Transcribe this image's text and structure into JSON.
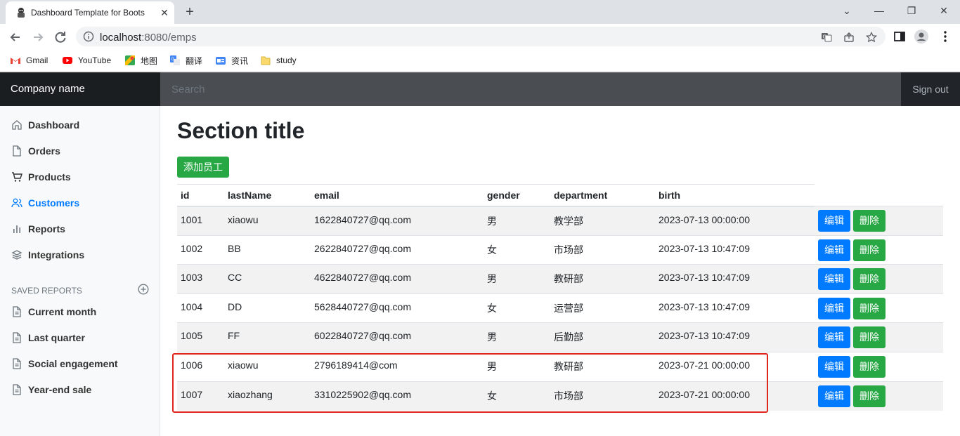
{
  "browser": {
    "tab_title": "Dashboard Template for Boots",
    "url_host": "localhost",
    "url_path": ":8080/emps",
    "bookmarks": [
      {
        "label": "Gmail",
        "icon": "gmail-icon"
      },
      {
        "label": "YouTube",
        "icon": "youtube-icon"
      },
      {
        "label": "地图",
        "icon": "maps-icon"
      },
      {
        "label": "翻译",
        "icon": "translate-icon"
      },
      {
        "label": "资讯",
        "icon": "news-icon"
      },
      {
        "label": "study",
        "icon": "folder-icon"
      }
    ]
  },
  "navbar": {
    "brand": "Company name",
    "search_placeholder": "Search",
    "sign_out": "Sign out"
  },
  "sidebar": {
    "items": [
      {
        "label": "Dashboard",
        "icon": "home-icon",
        "active": false
      },
      {
        "label": "Orders",
        "icon": "file-icon",
        "active": false
      },
      {
        "label": "Products",
        "icon": "shopping-cart-icon",
        "active": false
      },
      {
        "label": "Customers",
        "icon": "users-icon",
        "active": true
      },
      {
        "label": "Reports",
        "icon": "bar-chart-icon",
        "active": false
      },
      {
        "label": "Integrations",
        "icon": "layers-icon",
        "active": false
      }
    ],
    "saved_reports_heading": "Saved reports",
    "reports": [
      {
        "label": "Current month",
        "icon": "file-text-icon"
      },
      {
        "label": "Last quarter",
        "icon": "file-text-icon"
      },
      {
        "label": "Social engagement",
        "icon": "file-text-icon"
      },
      {
        "label": "Year-end sale",
        "icon": "file-text-icon"
      }
    ]
  },
  "main": {
    "title": "Section title",
    "add_button": "添加员工",
    "columns": [
      "id",
      "lastName",
      "email",
      "gender",
      "department",
      "birth"
    ],
    "edit_label": "编辑",
    "delete_label": "删除",
    "rows": [
      {
        "id": "1001",
        "lastName": "xiaowu",
        "email": "1622840727@qq.com",
        "gender": "男",
        "department": "教学部",
        "birth": "2023-07-13 00:00:00"
      },
      {
        "id": "1002",
        "lastName": "BB",
        "email": "2622840727@qq.com",
        "gender": "女",
        "department": "市场部",
        "birth": "2023-07-13 10:47:09"
      },
      {
        "id": "1003",
        "lastName": "CC",
        "email": "4622840727@qq.com",
        "gender": "男",
        "department": "教研部",
        "birth": "2023-07-13 10:47:09"
      },
      {
        "id": "1004",
        "lastName": "DD",
        "email": "5628440727@qq.com",
        "gender": "女",
        "department": "运营部",
        "birth": "2023-07-13 10:47:09"
      },
      {
        "id": "1005",
        "lastName": "FF",
        "email": "6022840727@qq.com",
        "gender": "男",
        "department": "后勤部",
        "birth": "2023-07-13 10:47:09"
      },
      {
        "id": "1006",
        "lastName": "xiaowu",
        "email": "2796189414@com",
        "gender": "男",
        "department": "教研部",
        "birth": "2023-07-21 00:00:00"
      },
      {
        "id": "1007",
        "lastName": "xiaozhang",
        "email": "3310225902@qq.com",
        "gender": "女",
        "department": "市场部",
        "birth": "2023-07-21 00:00:00"
      }
    ]
  },
  "colors": {
    "primary": "#007bff",
    "success": "#28a745",
    "navbar": "#212529",
    "highlight": "#e0261b"
  }
}
